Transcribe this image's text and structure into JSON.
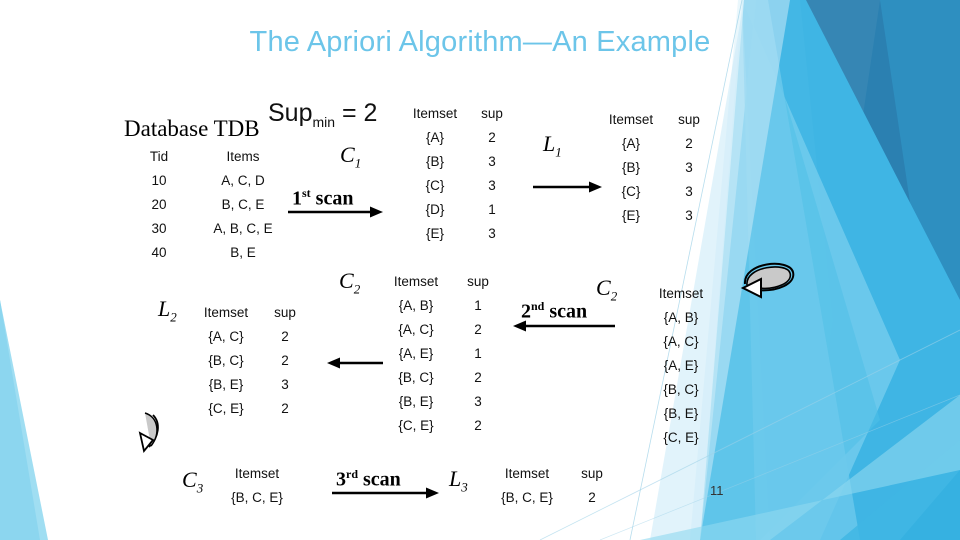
{
  "slide": {
    "title": "The Apriori Algorithm—An Example",
    "page_number": "11",
    "accent_color": "#6CC5E9",
    "title_color": "#6CC5E9",
    "background_colors": [
      "#6DC9EC",
      "#3FB6E4",
      "#2E8FC0",
      "#C9E9F7",
      "#E8F6FC",
      "#2B7FB0"
    ]
  },
  "database": {
    "caption": "Database TDB",
    "columns": [
      "Tid",
      "Items"
    ],
    "rows": [
      {
        "tid": "10",
        "items": "A, C, D"
      },
      {
        "tid": "20",
        "items": "B, C, E"
      },
      {
        "tid": "30",
        "items": "A, B, C, E"
      },
      {
        "tid": "40",
        "items": "B, E"
      }
    ]
  },
  "sup_min": {
    "name": "Sup",
    "sub": "min",
    "equals": "= 2",
    "full": "Supmin = 2"
  },
  "scans": {
    "first": {
      "ordinal": "1",
      "suffix": "st",
      "word": "scan"
    },
    "second": {
      "ordinal": "2",
      "suffix": "nd",
      "word": "scan"
    },
    "third": {
      "ordinal": "3",
      "suffix": "rd",
      "word": "scan"
    }
  },
  "labels": {
    "c1": {
      "base": "C",
      "sub": "1"
    },
    "l1": {
      "base": "L",
      "sub": "1"
    },
    "c2_mid": {
      "base": "C",
      "sub": "2"
    },
    "c2_right": {
      "base": "C",
      "sub": "2"
    },
    "l2": {
      "base": "L",
      "sub": "2"
    },
    "c3": {
      "base": "C",
      "sub": "3"
    },
    "l3": {
      "base": "L",
      "sub": "3"
    }
  },
  "tables": {
    "c1": {
      "columns": [
        "Itemset",
        "sup"
      ],
      "rows": [
        {
          "itemset": "{A}",
          "sup": "2"
        },
        {
          "itemset": "{B}",
          "sup": "3"
        },
        {
          "itemset": "{C}",
          "sup": "3"
        },
        {
          "itemset": "{D}",
          "sup": "1"
        },
        {
          "itemset": "{E}",
          "sup": "3"
        }
      ]
    },
    "l1": {
      "columns": [
        "Itemset",
        "sup"
      ],
      "rows": [
        {
          "itemset": "{A}",
          "sup": "2"
        },
        {
          "itemset": "{B}",
          "sup": "3"
        },
        {
          "itemset": "{C}",
          "sup": "3"
        },
        {
          "itemset": "{E}",
          "sup": "3"
        }
      ]
    },
    "c2_counts": {
      "columns": [
        "Itemset",
        "sup"
      ],
      "rows": [
        {
          "itemset": "{A, B}",
          "sup": "1"
        },
        {
          "itemset": "{A, C}",
          "sup": "2"
        },
        {
          "itemset": "{A, E}",
          "sup": "1"
        },
        {
          "itemset": "{B, C}",
          "sup": "2"
        },
        {
          "itemset": "{B, E}",
          "sup": "3"
        },
        {
          "itemset": "{C, E}",
          "sup": "2"
        }
      ]
    },
    "c2_candidates": {
      "columns": [
        "Itemset"
      ],
      "rows": [
        {
          "itemset": "{A, B}"
        },
        {
          "itemset": "{A, C}"
        },
        {
          "itemset": "{A, E}"
        },
        {
          "itemset": "{B, C}"
        },
        {
          "itemset": "{B, E}"
        },
        {
          "itemset": "{C, E}"
        }
      ]
    },
    "l2": {
      "columns": [
        "Itemset",
        "sup"
      ],
      "rows": [
        {
          "itemset": "{A, C}",
          "sup": "2"
        },
        {
          "itemset": "{B, C}",
          "sup": "2"
        },
        {
          "itemset": "{B, E}",
          "sup": "3"
        },
        {
          "itemset": "{C, E}",
          "sup": "2"
        }
      ]
    },
    "c3": {
      "columns": [
        "Itemset"
      ],
      "rows": [
        {
          "itemset": "{B, C, E}"
        }
      ]
    },
    "l3": {
      "columns": [
        "Itemset",
        "sup"
      ],
      "rows": [
        {
          "itemset": "{B, C, E}",
          "sup": "2"
        }
      ]
    }
  },
  "icons": {
    "loop_top_right": "curved-loop-arrow-icon",
    "loop_bottom_left": "curved-loop-arrow-icon"
  }
}
